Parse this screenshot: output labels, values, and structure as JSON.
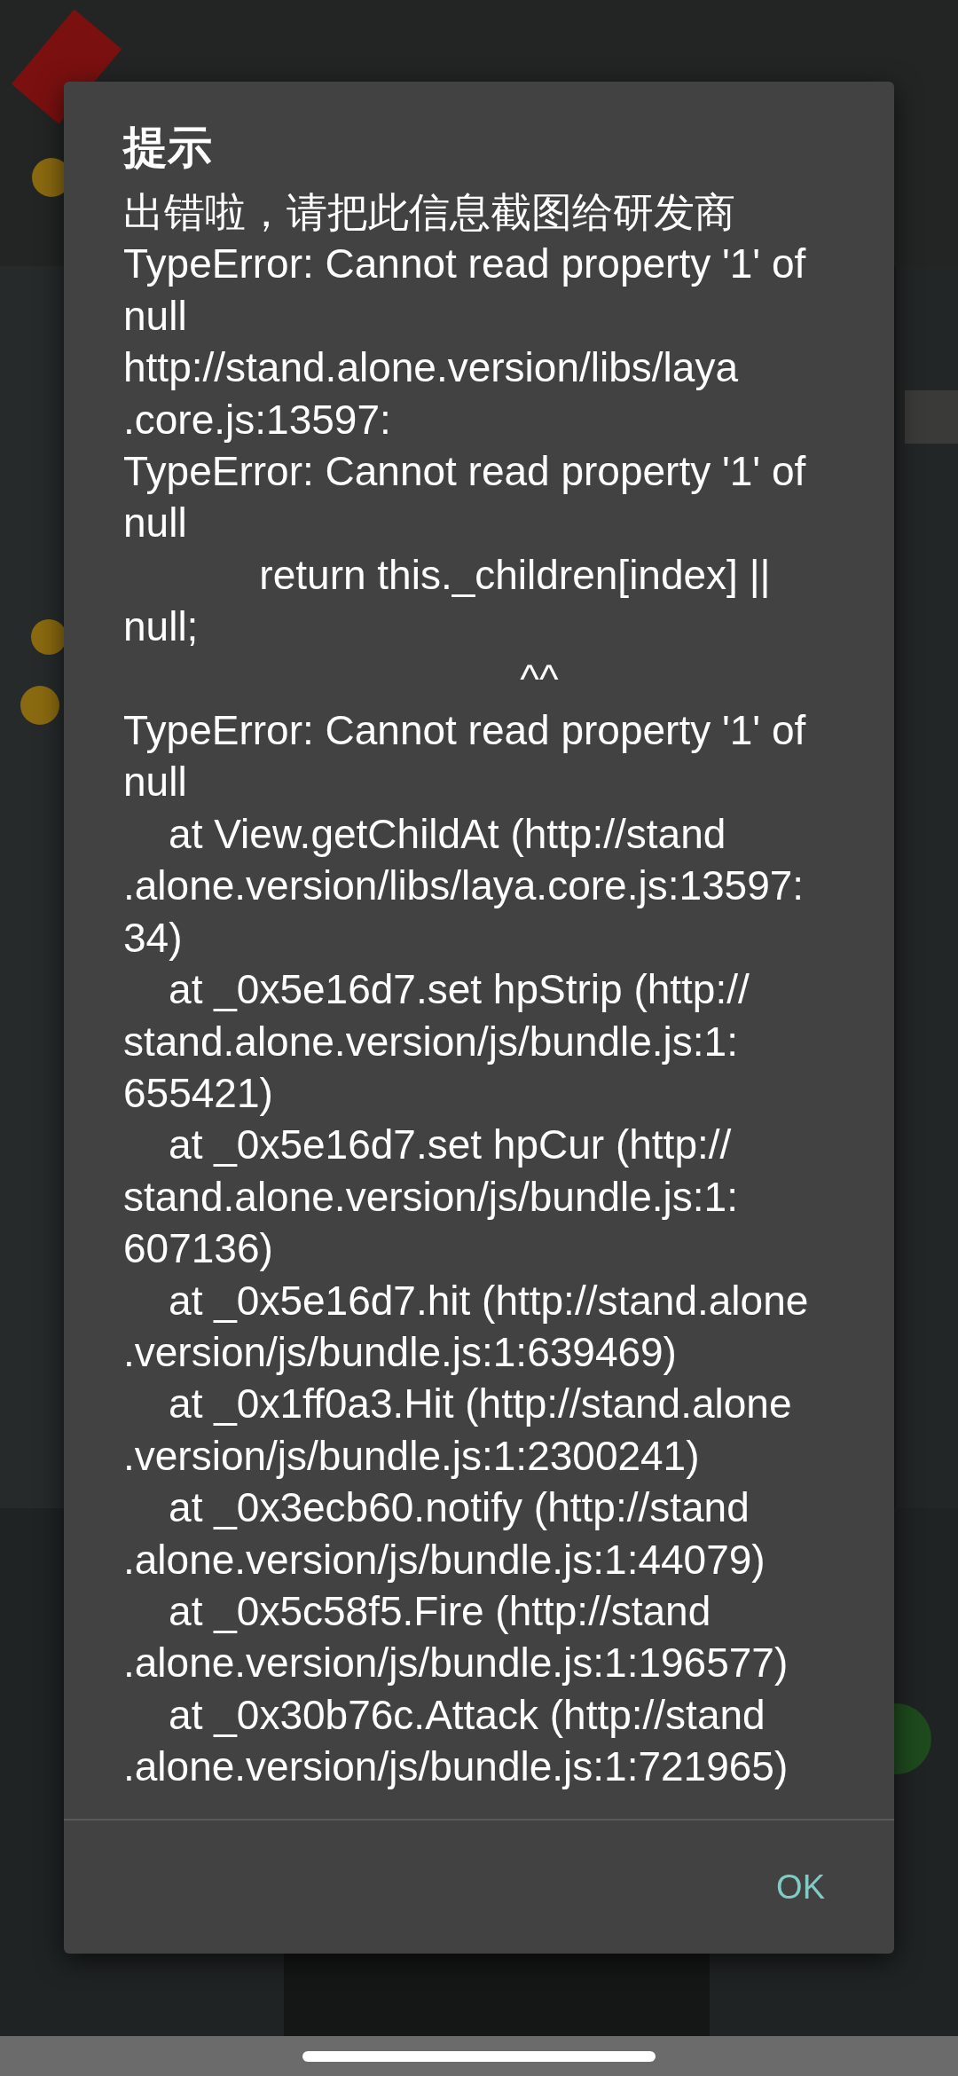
{
  "dialog": {
    "title": "提示",
    "message_lines": [
      "出错啦，请把此信息截图给研发商",
      "TypeError: Cannot read property '1' of",
      "null",
      "http://stand.alone.version/libs/laya",
      ".core.js:13597:",
      "TypeError: Cannot read property '1' of",
      "null",
      "            return this._children[index] ||",
      "null;",
      "                                   ^^",
      "TypeError: Cannot read property '1' of",
      "null",
      "    at View.getChildAt (http://stand",
      ".alone.version/libs/laya.core.js:13597:",
      "34)",
      "    at _0x5e16d7.set hpStrip (http://",
      "stand.alone.version/js/bundle.js:1:",
      "655421)",
      "    at _0x5e16d7.set hpCur (http://",
      "stand.alone.version/js/bundle.js:1:",
      "607136)",
      "    at _0x5e16d7.hit (http://stand.alone",
      ".version/js/bundle.js:1:639469)",
      "    at _0x1ff0a3.Hit (http://stand.alone",
      ".version/js/bundle.js:1:2300241)",
      "    at _0x3ecb60.notify (http://stand",
      ".alone.version/js/bundle.js:1:44079)",
      "    at _0x5c58f5.Fire (http://stand",
      ".alone.version/js/bundle.js:1:196577)",
      "    at _0x30b76c.Attack (http://stand",
      ".alone.version/js/bundle.js:1:721965)"
    ],
    "buttons": [
      "OK"
    ]
  }
}
